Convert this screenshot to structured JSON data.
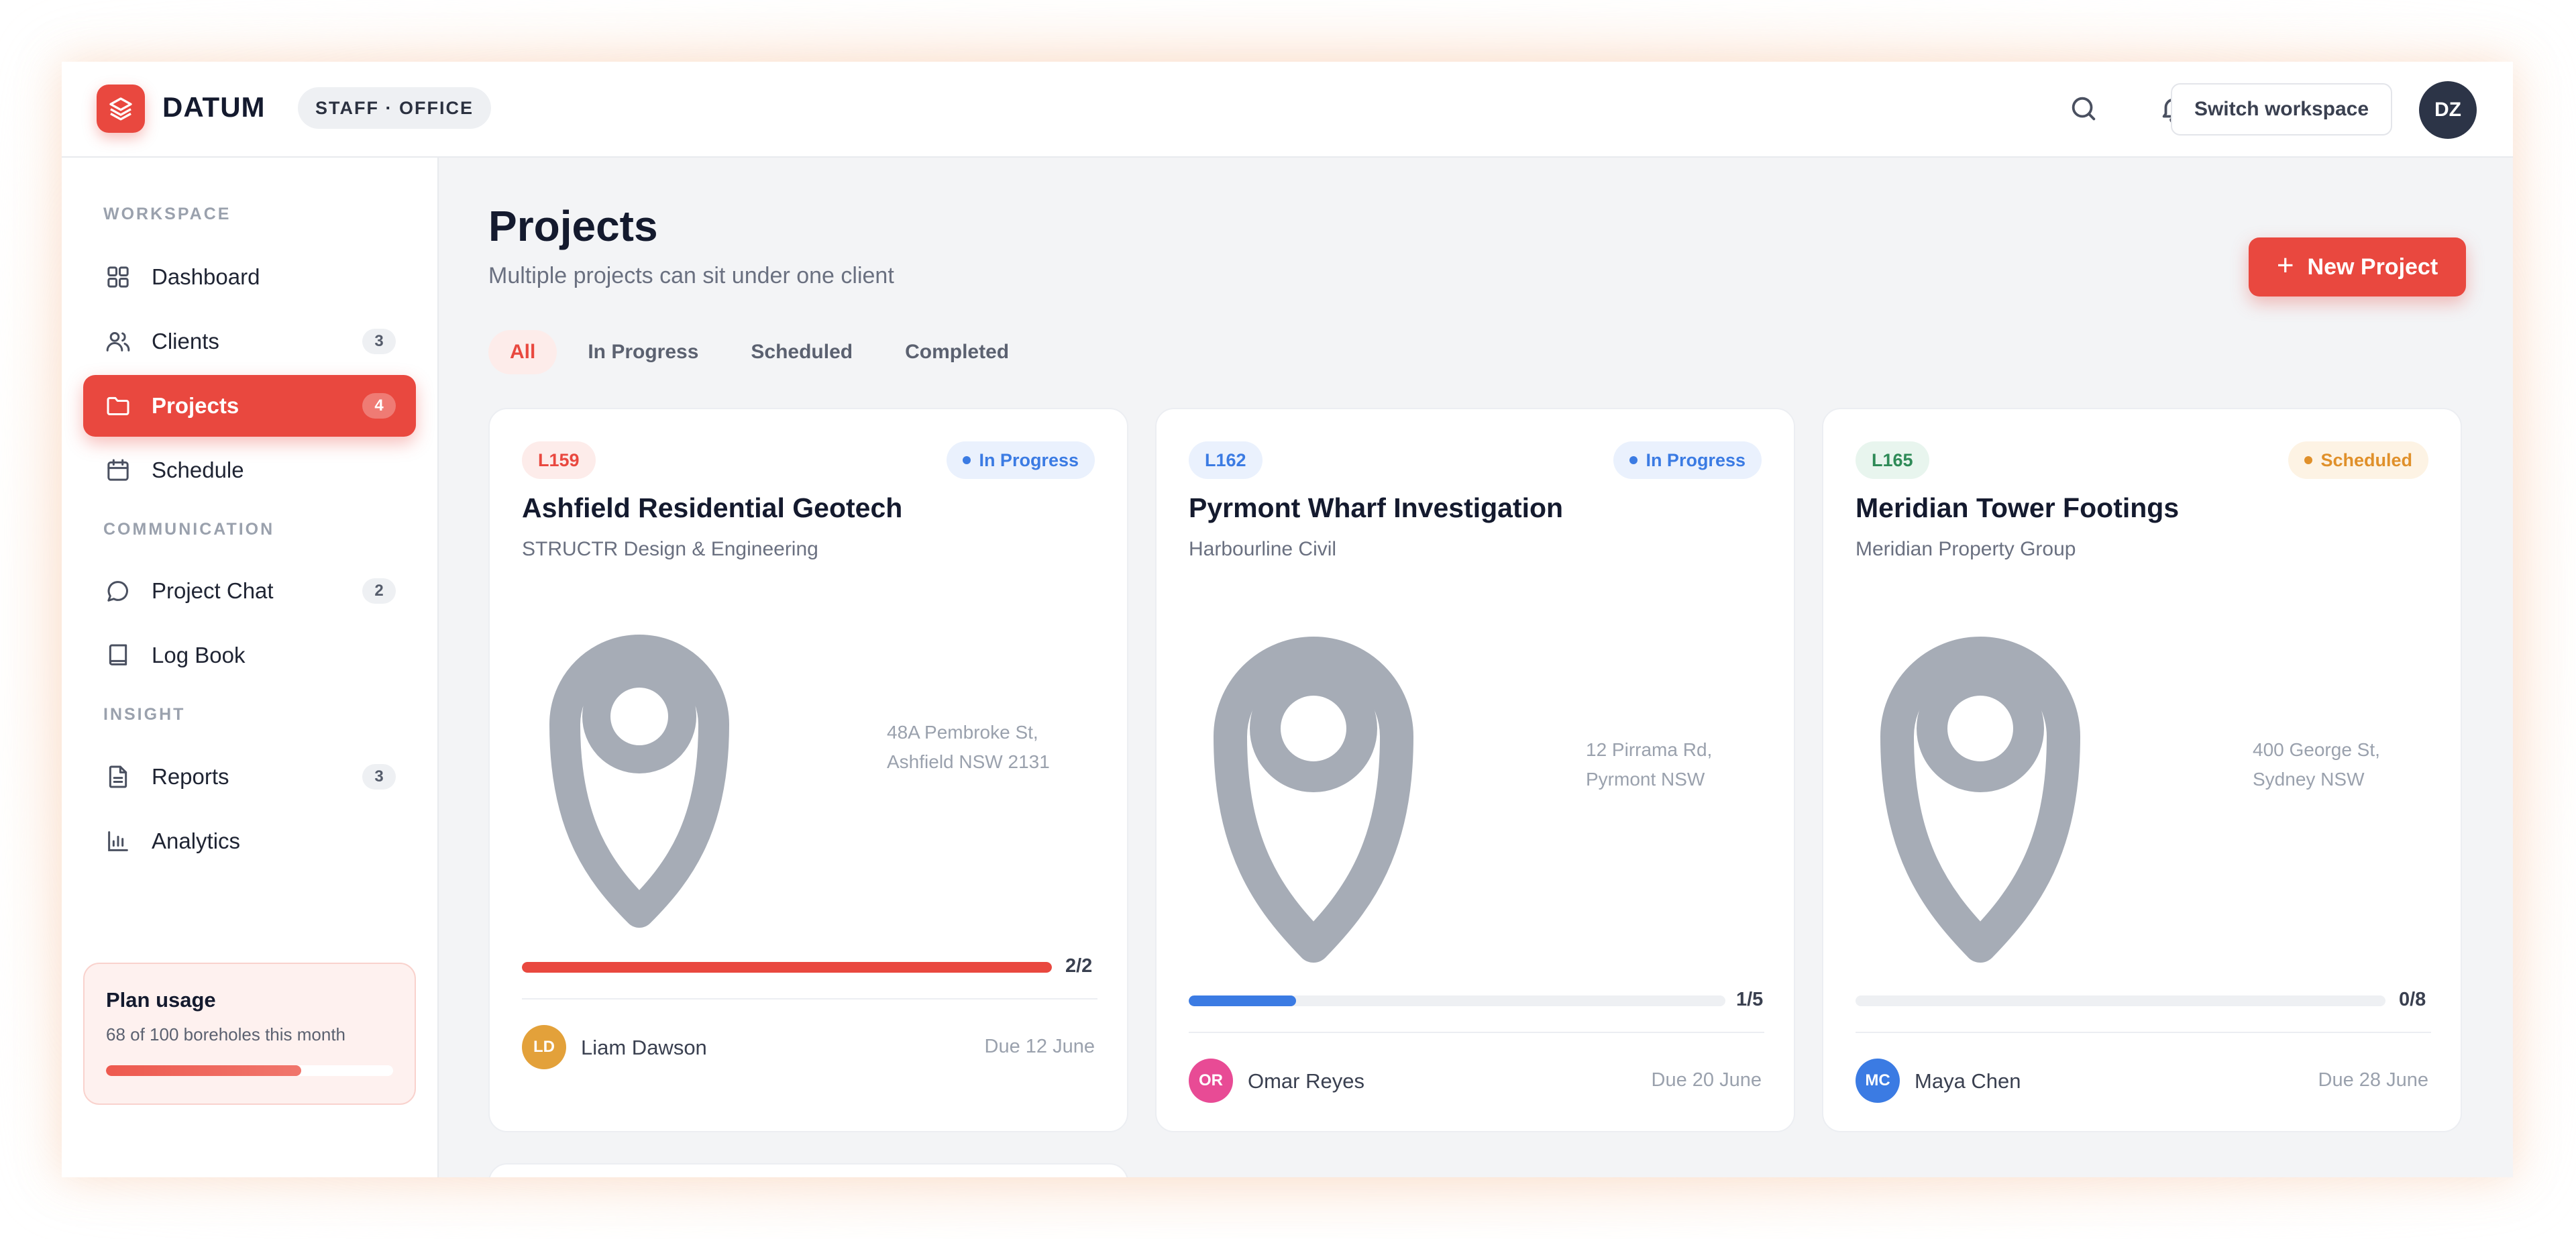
{
  "brand": {
    "name": "DATUM",
    "role": "STAFF · OFFICE",
    "accent": "#e9483f"
  },
  "topbar": {
    "switch_label": "Switch workspace",
    "user_initials": "DZ"
  },
  "sidebar": {
    "sections": [
      "WORKSPACE",
      "COMMUNICATION",
      "INSIGHT"
    ],
    "items": [
      {
        "label": "Dashboard",
        "icon": "grid-icon",
        "badge": ""
      },
      {
        "label": "Clients",
        "icon": "users-icon",
        "badge": "3"
      },
      {
        "label": "Projects",
        "icon": "folder-icon",
        "badge": "4",
        "active": true
      },
      {
        "label": "Schedule",
        "icon": "calendar-icon",
        "badge": ""
      },
      {
        "label": "Project Chat",
        "icon": "chat-icon",
        "badge": "2"
      },
      {
        "label": "Log Book",
        "icon": "book-icon",
        "badge": ""
      },
      {
        "label": "Reports",
        "icon": "file-icon",
        "badge": "3"
      },
      {
        "label": "Analytics",
        "icon": "bar-chart-icon",
        "badge": ""
      }
    ],
    "plan": {
      "title": "Plan usage",
      "subtitle": "68 of 100 boreholes this month",
      "used_fraction": 0.68
    }
  },
  "main": {
    "title": "Projects",
    "subtitle": "Multiple projects can sit under one client",
    "new_button": "New Project",
    "tabs": [
      "All",
      "In Progress",
      "Scheduled",
      "Completed"
    ],
    "active_tab": "All",
    "projects": [
      {
        "code": "L159",
        "code_color": "#e9483f",
        "code_bg": "#fdecea",
        "status": "In Progress",
        "status_color": "#3b7be3",
        "status_bg": "#eaf1fd",
        "title": "Ashfield Residential Geotech",
        "client": "STRUCTR Design & Engineering",
        "address_line1": "48A Pembroke St,",
        "address_line2": "Ashfield NSW 2131",
        "progress_label": "2/2",
        "progress_fraction": 1.0,
        "progress_color": "#e9483f",
        "owner_initials": "LD",
        "owner_name": "Liam Dawson",
        "owner_color": "#e3a13a",
        "due": "Due 12 June"
      },
      {
        "code": "L162",
        "code_color": "#3b7be3",
        "code_bg": "#eaf1fd",
        "status": "In Progress",
        "status_color": "#3b7be3",
        "status_bg": "#eaf1fd",
        "title": "Pyrmont Wharf Investigation",
        "client": "Harbourline Civil",
        "address_line1": "12 Pirrama Rd,",
        "address_line2": "Pyrmont NSW",
        "progress_label": "1/5",
        "progress_fraction": 0.2,
        "progress_color": "#3b7be3",
        "owner_initials": "OR",
        "owner_name": "Omar Reyes",
        "owner_color": "#e84b95",
        "due": "Due 20 June"
      },
      {
        "code": "L165",
        "code_color": "#2e8a57",
        "code_bg": "#e8f5ee",
        "status": "Scheduled",
        "status_color": "#e0902a",
        "status_bg": "#fdf3e4",
        "title": "Meridian Tower Footings",
        "client": "Meridian Property Group",
        "address_line1": "400 George St,",
        "address_line2": "Sydney NSW",
        "progress_label": "0/8",
        "progress_fraction": 0.0,
        "progress_color": "#3b7be3",
        "owner_initials": "MC",
        "owner_name": "Maya Chen",
        "owner_color": "#3b7be3",
        "due": "Due 28 June"
      }
    ]
  }
}
